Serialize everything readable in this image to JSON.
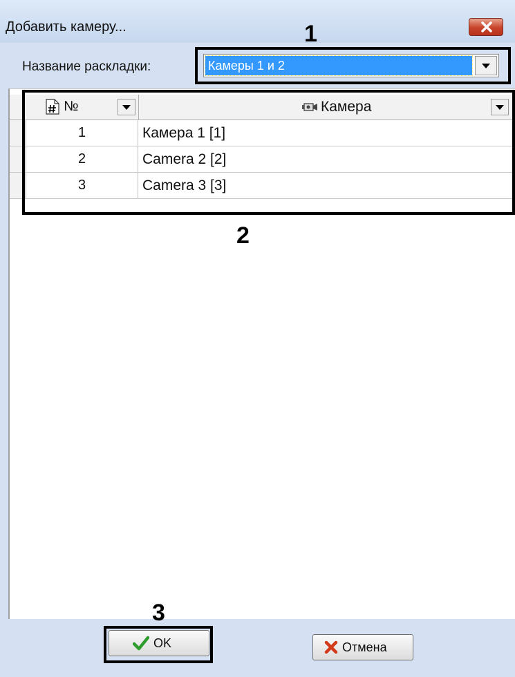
{
  "window": {
    "title": "Добавить камеру..."
  },
  "layout": {
    "label": "Название раскладки:",
    "value": "Камеры 1 и 2"
  },
  "table": {
    "columns": {
      "num": "№",
      "camera": "Камера"
    },
    "rows": [
      {
        "num": "1",
        "camera": "Камера 1 [1]"
      },
      {
        "num": "2",
        "camera": "Camera 2 [2]"
      },
      {
        "num": "3",
        "camera": "Camera 3 [3]"
      }
    ]
  },
  "buttons": {
    "ok": "OK",
    "cancel": "Отмена"
  },
  "annotations": {
    "one": "1",
    "two": "2",
    "three": "3"
  },
  "colors": {
    "selection": "#3399ff",
    "window_bg": "#d5e1f2",
    "close": "#c7432a",
    "ok_check": "#2e9d2e",
    "cancel_x": "#d23a1a"
  },
  "icons": [
    "close-icon",
    "dropdown-arrow-icon",
    "hash-icon",
    "camera-icon",
    "checkmark-icon",
    "cross-icon"
  ]
}
